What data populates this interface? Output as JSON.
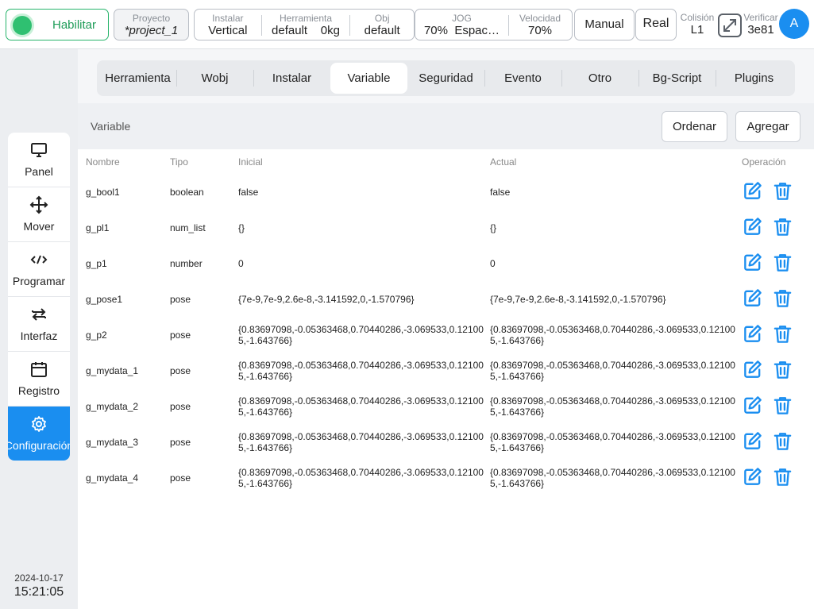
{
  "topbar": {
    "enable_label": "Habilitar",
    "project": {
      "label": "Proyecto",
      "value": "*project_1"
    },
    "install": {
      "label": "Instalar",
      "value": "Vertical"
    },
    "tool": {
      "label": "Herramienta",
      "value_name": "default",
      "value_weight": "0kg"
    },
    "obj": {
      "label": "Obj",
      "value": "default"
    },
    "jog": {
      "label": "JOG",
      "value_percent": "70%",
      "value_mode": "Espac…"
    },
    "speed": {
      "label": "Velocidad",
      "value": "70%"
    },
    "manual_label": "Manual",
    "real_label": "Real",
    "collision": {
      "label": "Colisión",
      "value": "L1"
    },
    "verify": {
      "label": "Verificar",
      "value": "3e81"
    },
    "avatar_initial": "A",
    "accent_color": "#1a8ef0",
    "enable_color": "#27b46b"
  },
  "sidebar": {
    "items": [
      {
        "label": "Panel",
        "icon": "monitor-icon"
      },
      {
        "label": "Mover",
        "icon": "move-arrows-icon"
      },
      {
        "label": "Programar",
        "icon": "code-icon"
      },
      {
        "label": "Interfaz",
        "icon": "swap-arrows-icon"
      },
      {
        "label": "Registro",
        "icon": "calendar-icon"
      },
      {
        "label": "Configuración",
        "icon": "gear-icon",
        "active": true
      }
    ],
    "date": "2024-10-17",
    "time": "15:21:05"
  },
  "tabs": [
    {
      "label": "Herramienta"
    },
    {
      "label": "Wobj"
    },
    {
      "label": "Instalar"
    },
    {
      "label": "Variable",
      "active": true
    },
    {
      "label": "Seguridad"
    },
    {
      "label": "Evento"
    },
    {
      "label": "Otro"
    },
    {
      "label": "Bg-Script"
    },
    {
      "label": "Plugins"
    }
  ],
  "section": {
    "title": "Variable",
    "sort_label": "Ordenar",
    "add_label": "Agregar"
  },
  "table": {
    "headers": {
      "name": "Nombre",
      "type": "Tipo",
      "initial": "Inicial",
      "current": "Actual",
      "operation": "Operación"
    },
    "rows": [
      {
        "name": "g_bool1",
        "type": "boolean",
        "initial": "false",
        "current": "false"
      },
      {
        "name": "g_pl1",
        "type": "num_list",
        "initial": "{}",
        "current": "{}"
      },
      {
        "name": "g_p1",
        "type": "number",
        "initial": "0",
        "current": "0"
      },
      {
        "name": "g_pose1",
        "type": "pose",
        "initial": "{7e-9,7e-9,2.6e-8,-3.141592,0,-1.570796}",
        "current": "{7e-9,7e-9,2.6e-8,-3.141592,0,-1.570796}"
      },
      {
        "name": "g_p2",
        "type": "pose",
        "initial": "{0.83697098,-0.05363468,0.70440286,-3.069533,0.121005,-1.643766}",
        "current": "{0.83697098,-0.05363468,0.70440286,-3.069533,0.121005,-1.643766}"
      },
      {
        "name": "g_mydata_1",
        "type": "pose",
        "initial": "{0.83697098,-0.05363468,0.70440286,-3.069533,0.121005,-1.643766}",
        "current": "{0.83697098,-0.05363468,0.70440286,-3.069533,0.121005,-1.643766}"
      },
      {
        "name": "g_mydata_2",
        "type": "pose",
        "initial": "{0.83697098,-0.05363468,0.70440286,-3.069533,0.121005,-1.643766}",
        "current": "{0.83697098,-0.05363468,0.70440286,-3.069533,0.121005,-1.643766}"
      },
      {
        "name": "g_mydata_3",
        "type": "pose",
        "initial": "{0.83697098,-0.05363468,0.70440286,-3.069533,0.121005,-1.643766}",
        "current": "{0.83697098,-0.05363468,0.70440286,-3.069533,0.121005,-1.643766}"
      },
      {
        "name": "g_mydata_4",
        "type": "pose",
        "initial": "{0.83697098,-0.05363468,0.70440286,-3.069533,0.121005,-1.643766}",
        "current": "{0.83697098,-0.05363468,0.70440286,-3.069533,0.121005,-1.643766}"
      }
    ],
    "row_actions": [
      "edit-icon",
      "trash-icon"
    ]
  }
}
